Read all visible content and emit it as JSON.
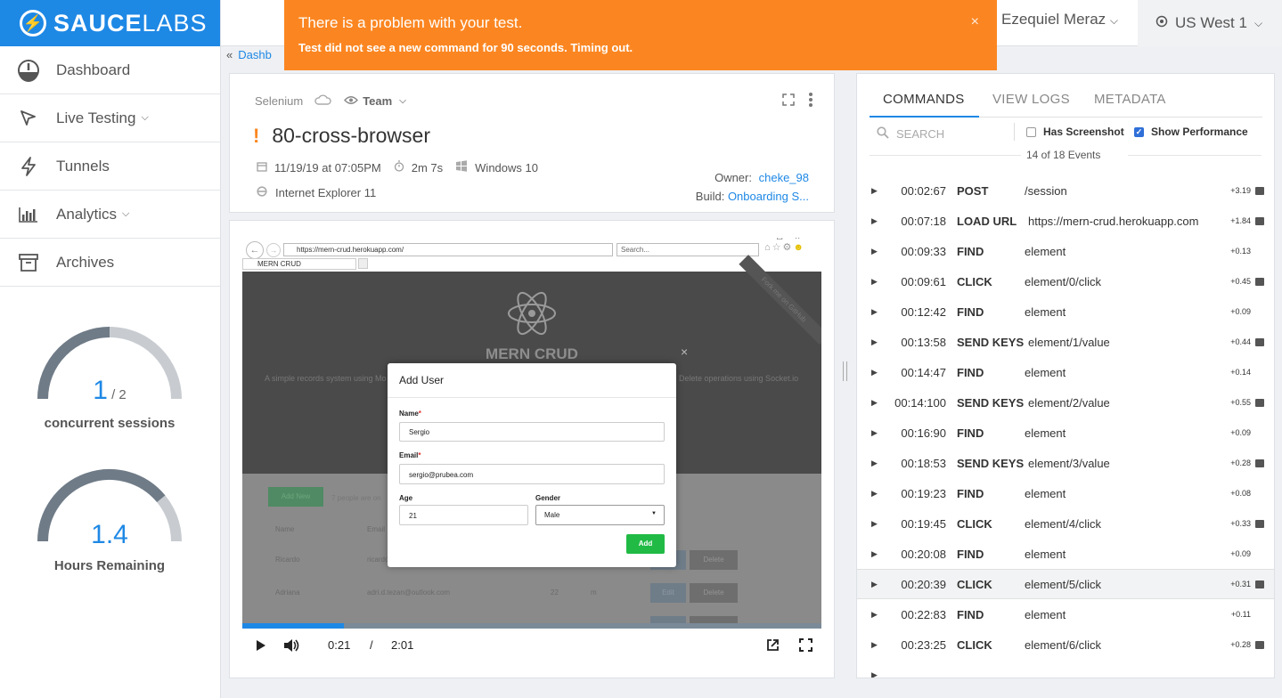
{
  "brand": {
    "name_bold": "SAUCE",
    "name_light": "LABS",
    "color": "#1e88e5"
  },
  "nav": [
    {
      "label": "Dashboard",
      "icon": "dashboard-icon",
      "chevron": false
    },
    {
      "label": "Live Testing",
      "icon": "cursor-icon",
      "chevron": true
    },
    {
      "label": "Tunnels",
      "icon": "bolt-icon",
      "chevron": false
    },
    {
      "label": "Analytics",
      "icon": "bar-chart-icon",
      "chevron": true
    },
    {
      "label": "Archives",
      "icon": "archive-icon",
      "chevron": false
    }
  ],
  "gauges": {
    "concurrent": {
      "value": "1",
      "max": "/ 2",
      "caption": "concurrent sessions",
      "fraction": 0.5
    },
    "hours": {
      "value": "1.4",
      "caption": "Hours Remaining",
      "fraction": 0.78
    }
  },
  "header": {
    "user": "Ezequiel Meraz",
    "region": "US West 1"
  },
  "toast": {
    "title": "There is a problem with your test.",
    "message": "Test did not see a new command for 90 seconds. Timing out.",
    "close": "×",
    "color": "#fb8621"
  },
  "breadcrumb": "Dashb",
  "job": {
    "framework": "Selenium",
    "visibility": "Team",
    "status_mark": "!",
    "name": "80-cross-browser",
    "date": "11/19/19 at 07:05PM",
    "duration": "2m 7s",
    "os": "Windows 10",
    "browser": "Internet Explorer 11",
    "owner_label": "Owner:",
    "owner": "cheke_98",
    "build_label": "Build:",
    "build": "Onboarding S..."
  },
  "video": {
    "address": "https://mern-crud.herokuapp.com/",
    "search_placeholder": "Search...",
    "tab_title": "MERN CRUD",
    "app_title": "MERN CRUD",
    "ribbon": "Fork me on GitHub",
    "app_desc_left": "A simple records system using Mo",
    "app_desc_right": "Delete operations using Socket.io",
    "modal": {
      "title": "Add User",
      "name_label": "Name",
      "name_value": "Sergio",
      "email_label": "Email",
      "email_value": "sergio@prubea.com",
      "age_label": "Age",
      "age_value": "21",
      "gender_label": "Gender",
      "gender_value": "Male",
      "add": "Add",
      "close": "×"
    },
    "bg": {
      "add_new": "Add New",
      "count": "7 people are on",
      "col_name": "Name",
      "col_email": "Email",
      "rows": [
        {
          "name": "Ricardo",
          "email": "ricardo",
          "edit": "Edit",
          "delete": "Delete"
        },
        {
          "name": "Adriana",
          "email": "adri.d.tezan@outlook.com",
          "age": "22",
          "gender": "m",
          "edit": "Edit",
          "delete": "Delete"
        }
      ]
    },
    "time_current": "0:21",
    "time_sep": "/",
    "time_total": "2:01",
    "progress": 0.175
  },
  "commands_panel": {
    "tabs": [
      "COMMANDS",
      "VIEW LOGS",
      "METADATA"
    ],
    "search_placeholder": "SEARCH",
    "has_screenshot": "Has Screenshot",
    "show_performance": "Show Performance",
    "event_count": "14 of 18 Events",
    "rows": [
      {
        "time": "00:02:67",
        "cmd": "POST",
        "arg": "/session",
        "dur": "+3.19",
        "shot": true
      },
      {
        "time": "00:07:18",
        "cmd": "LOAD URL",
        "arg": "https://mern-crud.herokuapp.com",
        "dur": "+1.84",
        "shot": true
      },
      {
        "time": "00:09:33",
        "cmd": "FIND",
        "arg": "element",
        "dur": "+0.13",
        "shot": false
      },
      {
        "time": "00:09:61",
        "cmd": "CLICK",
        "arg": "element/0/click",
        "dur": "+0.45",
        "shot": true
      },
      {
        "time": "00:12:42",
        "cmd": "FIND",
        "arg": "element",
        "dur": "+0.09",
        "shot": false
      },
      {
        "time": "00:13:58",
        "cmd": "SEND KEYS",
        "arg": "element/1/value",
        "dur": "+0.44",
        "shot": true
      },
      {
        "time": "00:14:47",
        "cmd": "FIND",
        "arg": "element",
        "dur": "+0.14",
        "shot": false
      },
      {
        "time": "00:14:100",
        "cmd": "SEND KEYS",
        "arg": "element/2/value",
        "dur": "+0.55",
        "shot": true
      },
      {
        "time": "00:16:90",
        "cmd": "FIND",
        "arg": "element",
        "dur": "+0.09",
        "shot": false
      },
      {
        "time": "00:18:53",
        "cmd": "SEND KEYS",
        "arg": "element/3/value",
        "dur": "+0.28",
        "shot": true
      },
      {
        "time": "00:19:23",
        "cmd": "FIND",
        "arg": "element",
        "dur": "+0.08",
        "shot": false
      },
      {
        "time": "00:19:45",
        "cmd": "CLICK",
        "arg": "element/4/click",
        "dur": "+0.33",
        "shot": true
      },
      {
        "time": "00:20:08",
        "cmd": "FIND",
        "arg": "element",
        "dur": "+0.09",
        "shot": false
      },
      {
        "time": "00:20:39",
        "cmd": "CLICK",
        "arg": "element/5/click",
        "dur": "+0.31",
        "shot": true,
        "highlight": true
      },
      {
        "time": "00:22:83",
        "cmd": "FIND",
        "arg": "element",
        "dur": "+0.11",
        "shot": false
      },
      {
        "time": "00:23:25",
        "cmd": "CLICK",
        "arg": "element/6/click",
        "dur": "+0.28",
        "shot": true
      }
    ]
  }
}
